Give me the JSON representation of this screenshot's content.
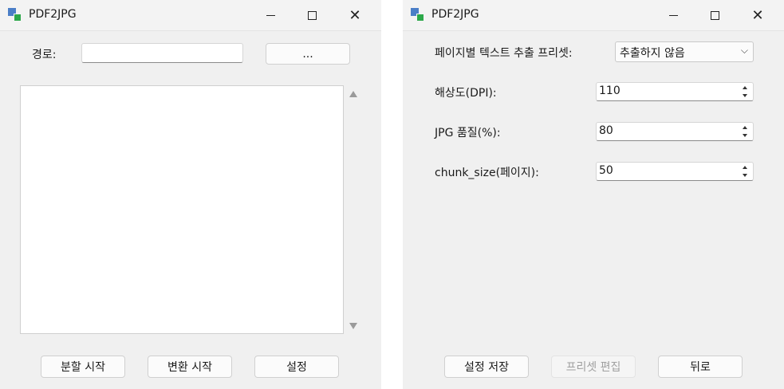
{
  "left_window": {
    "title": "PDF2JPG",
    "path_label": "경로:",
    "path_value": "",
    "browse_label": "...",
    "buttons": {
      "split": "분할 시작",
      "convert": "변환 시작",
      "settings": "설정"
    }
  },
  "right_window": {
    "title": "PDF2JPG",
    "preset_label": "페이지별 텍스트 추출 프리셋:",
    "preset_value": "추출하지 않음",
    "dpi_label": "해상도(DPI):",
    "dpi_value": "110",
    "quality_label": "JPG 품질(%):",
    "quality_value": "80",
    "chunk_label": "chunk_size(페이지):",
    "chunk_value": "50",
    "buttons": {
      "save": "설정 저장",
      "edit_preset": "프리셋 편집",
      "back": "뒤로"
    }
  },
  "icons": {
    "app": "app-icon",
    "minimize": "minimize-icon",
    "maximize": "maximize-icon",
    "close": "close-icon",
    "scroll_up": "scroll-up-icon",
    "scroll_down": "scroll-down-icon",
    "dropdown": "chevron-down-icon",
    "spin_up": "spin-up-icon",
    "spin_down": "spin-down-icon"
  },
  "colors": {
    "window_bg": "#f0f0f0",
    "titlebar_bg": "#f3f3f3",
    "app_icon_blue": "#4a7ec7",
    "app_icon_green": "#2ca84a"
  }
}
